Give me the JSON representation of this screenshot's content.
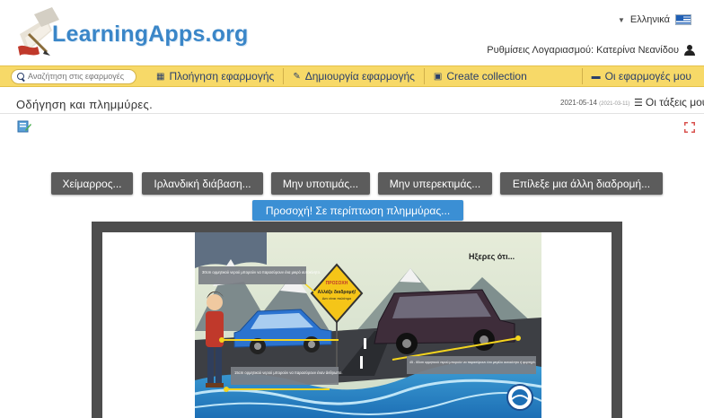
{
  "header": {
    "logo_text": "LearningApps.org",
    "language": "Ελληνικά",
    "account_label": "Ρυθμίσεις Λογαριασμού: Κατερίνα Νεανίδου"
  },
  "toolbar": {
    "search_placeholder": "Αναζήτηση στις εφαρμογές",
    "browse_label": "Πλοήγηση εφαρμογής",
    "create_label": "Δημιουργία εφαρμογής",
    "collection_label": "Create collection",
    "my_apps_label": "Οι εφαρμογές μου"
  },
  "app": {
    "title": "Οδήγηση και πλημμύρες.",
    "date": "2021-05-14",
    "date_small": "(2021-03-11)",
    "classes_label": "Οι τάξεις μου"
  },
  "choices": [
    "Χείμαρρος...",
    "Ιρλανδική διάβαση...",
    "Μην υποτιμάς...",
    "Μην υπερεκτιμάς...",
    "Επίλεξε μια άλλη διαδρομή..."
  ],
  "active_choice": "Προσοχή! Σε περίπτωση πλημμύρας...",
  "illustration": {
    "heading": "Ηξερες ότι...",
    "sign_title": "ΠΡΟΣΟΧΗ",
    "sign_text_1": "Αλλάξε διαδρομή!",
    "sign_text_2": "Δεν είναι πολύτιμο",
    "note_1": "30cm ορμητικού νερού μπορούν να παρασύρουν ένα μικρό αυτοκίνητο.",
    "note_2": "15cm ορμητικού νερού μπορούν να παρασύρουν έναν άνθρωπο.",
    "note_3": "45 - 60cm ορμητικού νερού μπορούν να παρασύρουν ένα μεγάλο αυτοκίνητο ή φορτηγό."
  },
  "colors": {
    "toolbar": "#f7d968",
    "logo": "#3a86c8",
    "dark_button": "#5c5c5c",
    "active_button": "#3b8fd4",
    "frame": "#4d4d4d"
  }
}
